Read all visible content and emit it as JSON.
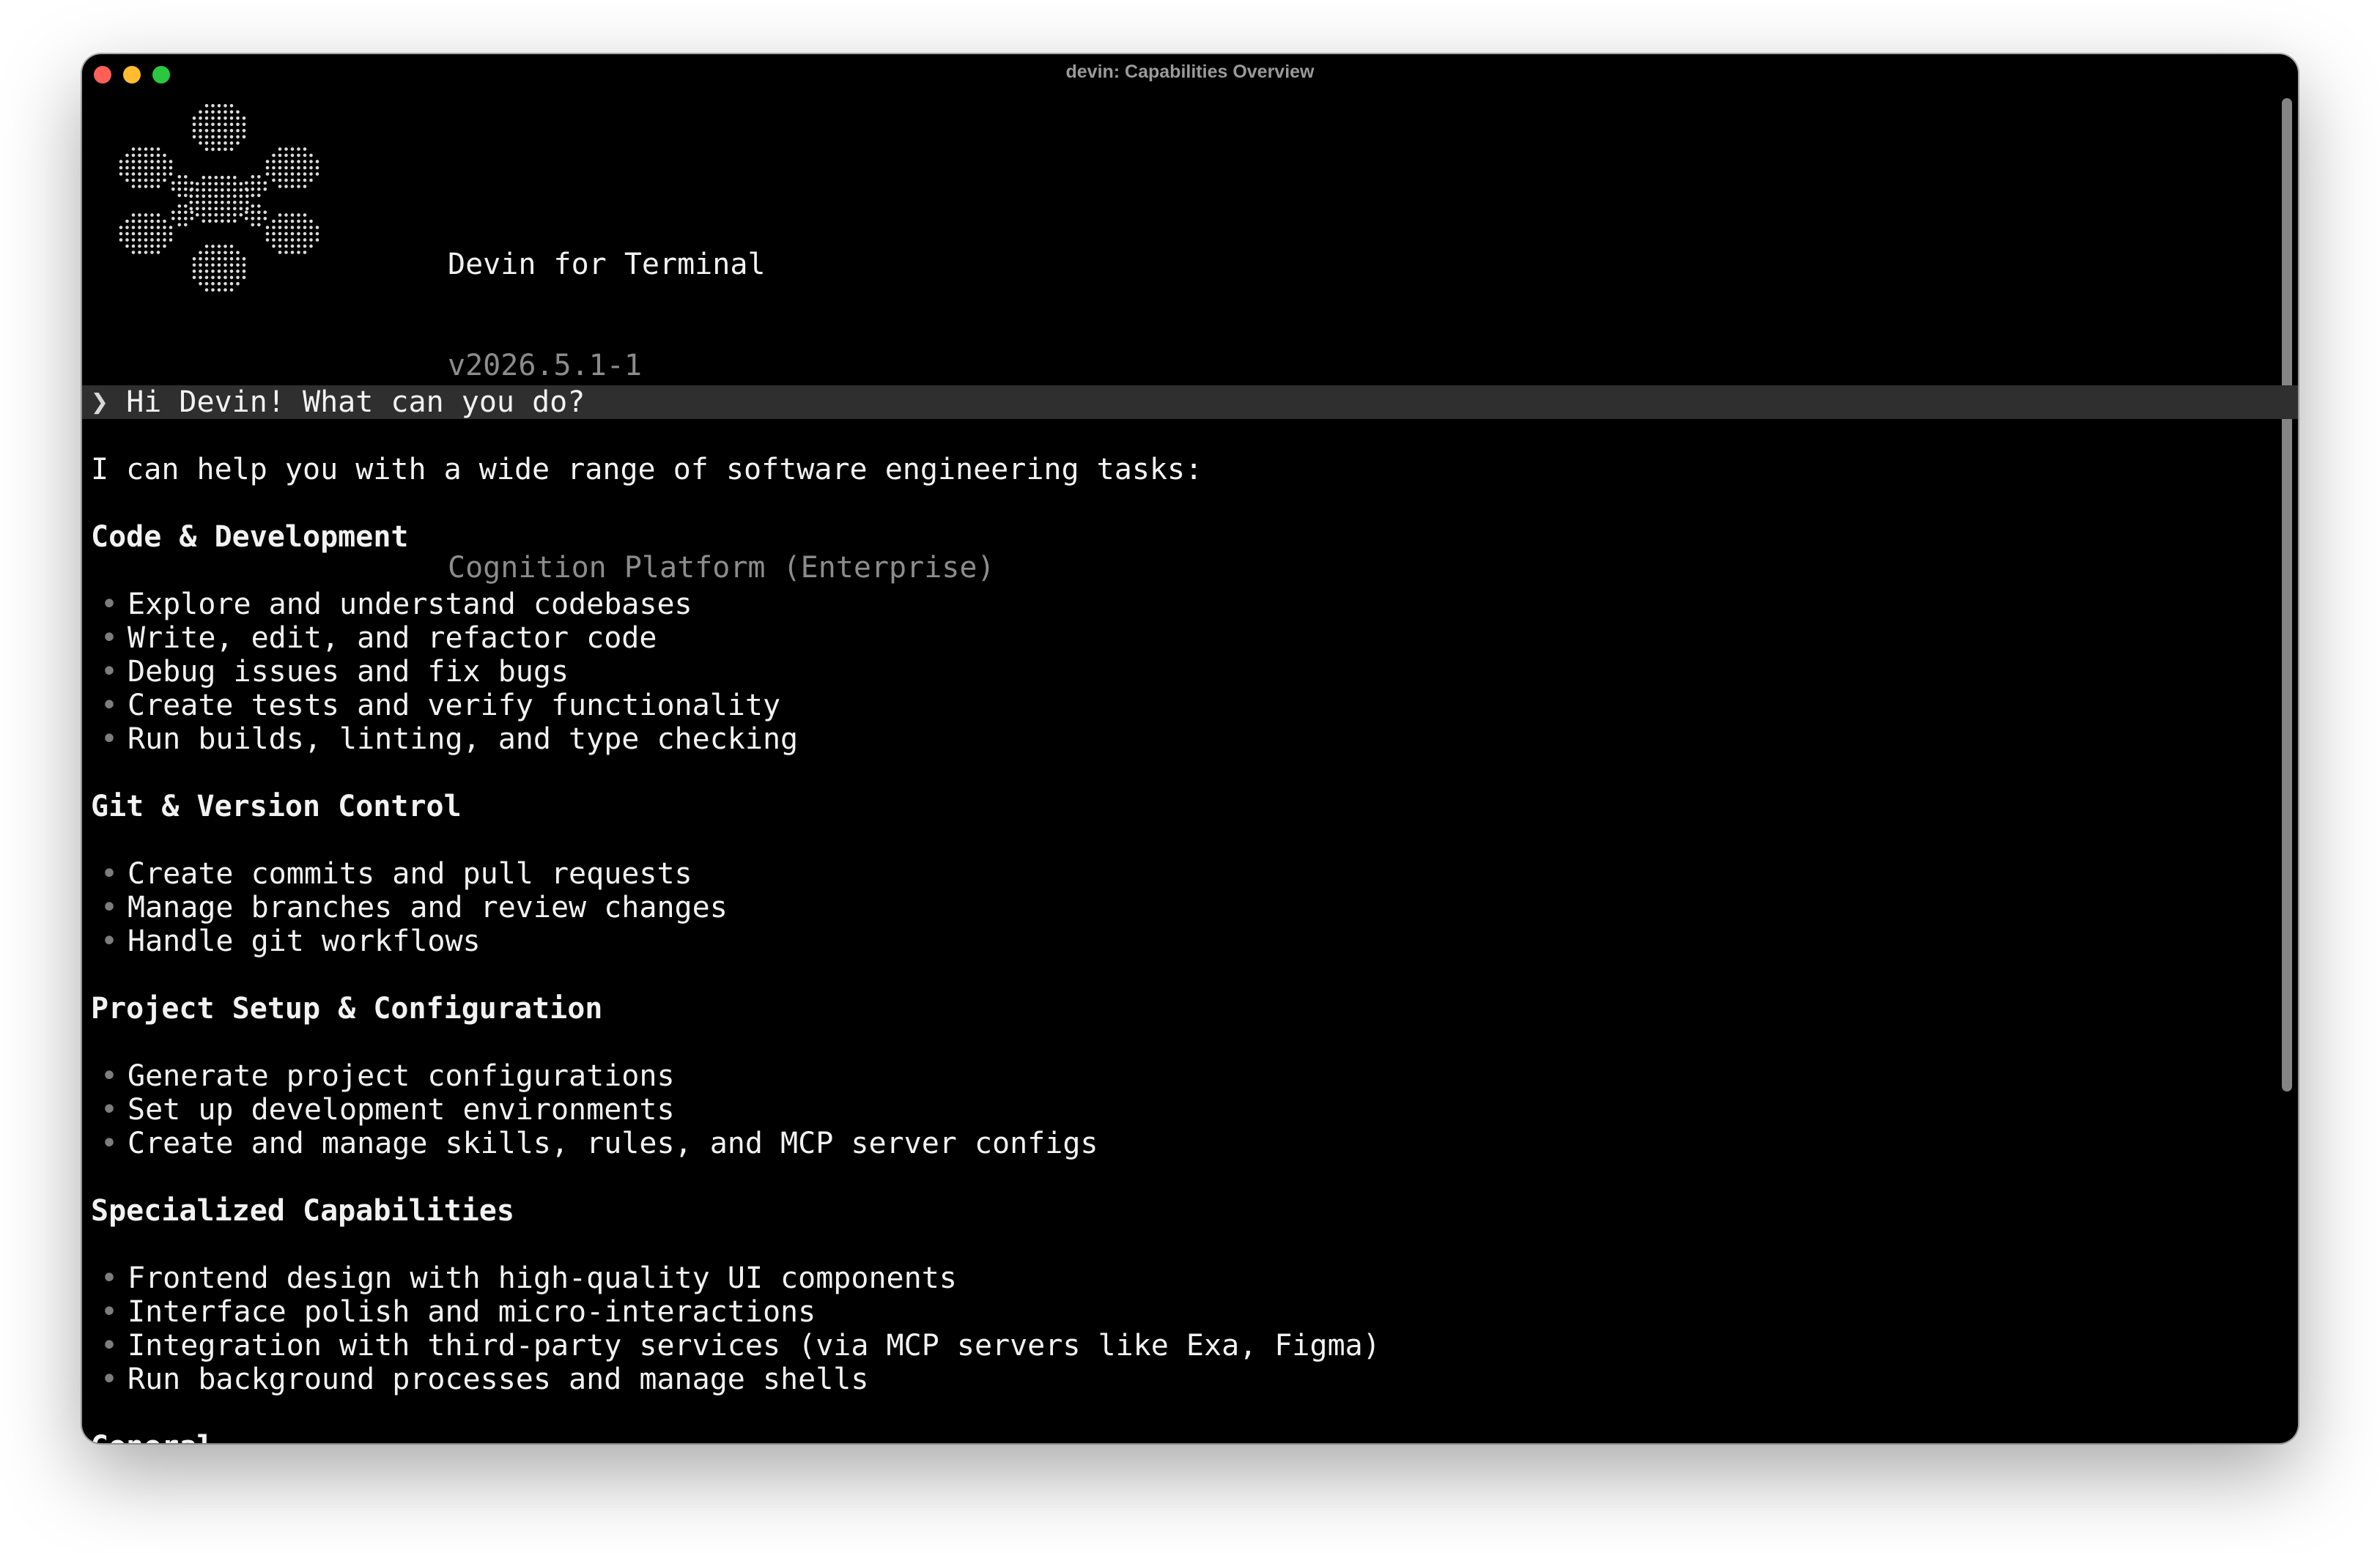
{
  "window": {
    "title": "devin: Capabilities Overview"
  },
  "header": {
    "app_name": "Devin for Terminal",
    "version": "v2026.5.1-1",
    "platform": "Cognition Platform (Enterprise)",
    "logo_icon": "devin-dotted-logo-icon"
  },
  "prompt": {
    "symbol": "❯",
    "text": "Hi Devin! What can you do?"
  },
  "response": {
    "intro": "I can help you with a wide range of software engineering tasks:",
    "bullet_symbol": "•",
    "sections": [
      {
        "heading": "Code & Development",
        "items": [
          "Explore and understand codebases",
          "Write, edit, and refactor code",
          "Debug issues and fix bugs",
          "Create tests and verify functionality",
          "Run builds, linting, and type checking"
        ]
      },
      {
        "heading": "Git & Version Control",
        "items": [
          "Create commits and pull requests",
          "Manage branches and review changes",
          "Handle git workflows"
        ]
      },
      {
        "heading": "Project Setup & Configuration",
        "items": [
          "Generate project configurations",
          "Set up development environments",
          "Create and manage skills, rules, and MCP server configs"
        ]
      },
      {
        "heading": "Specialized Capabilities",
        "items": [
          "Frontend design with high-quality UI components",
          "Interface polish and micro-interactions",
          "Integration with third-party services (via MCP servers like Exa, Figma)",
          "Run background processes and manage shells"
        ]
      },
      {
        "heading": "General",
        "items": []
      }
    ]
  }
}
